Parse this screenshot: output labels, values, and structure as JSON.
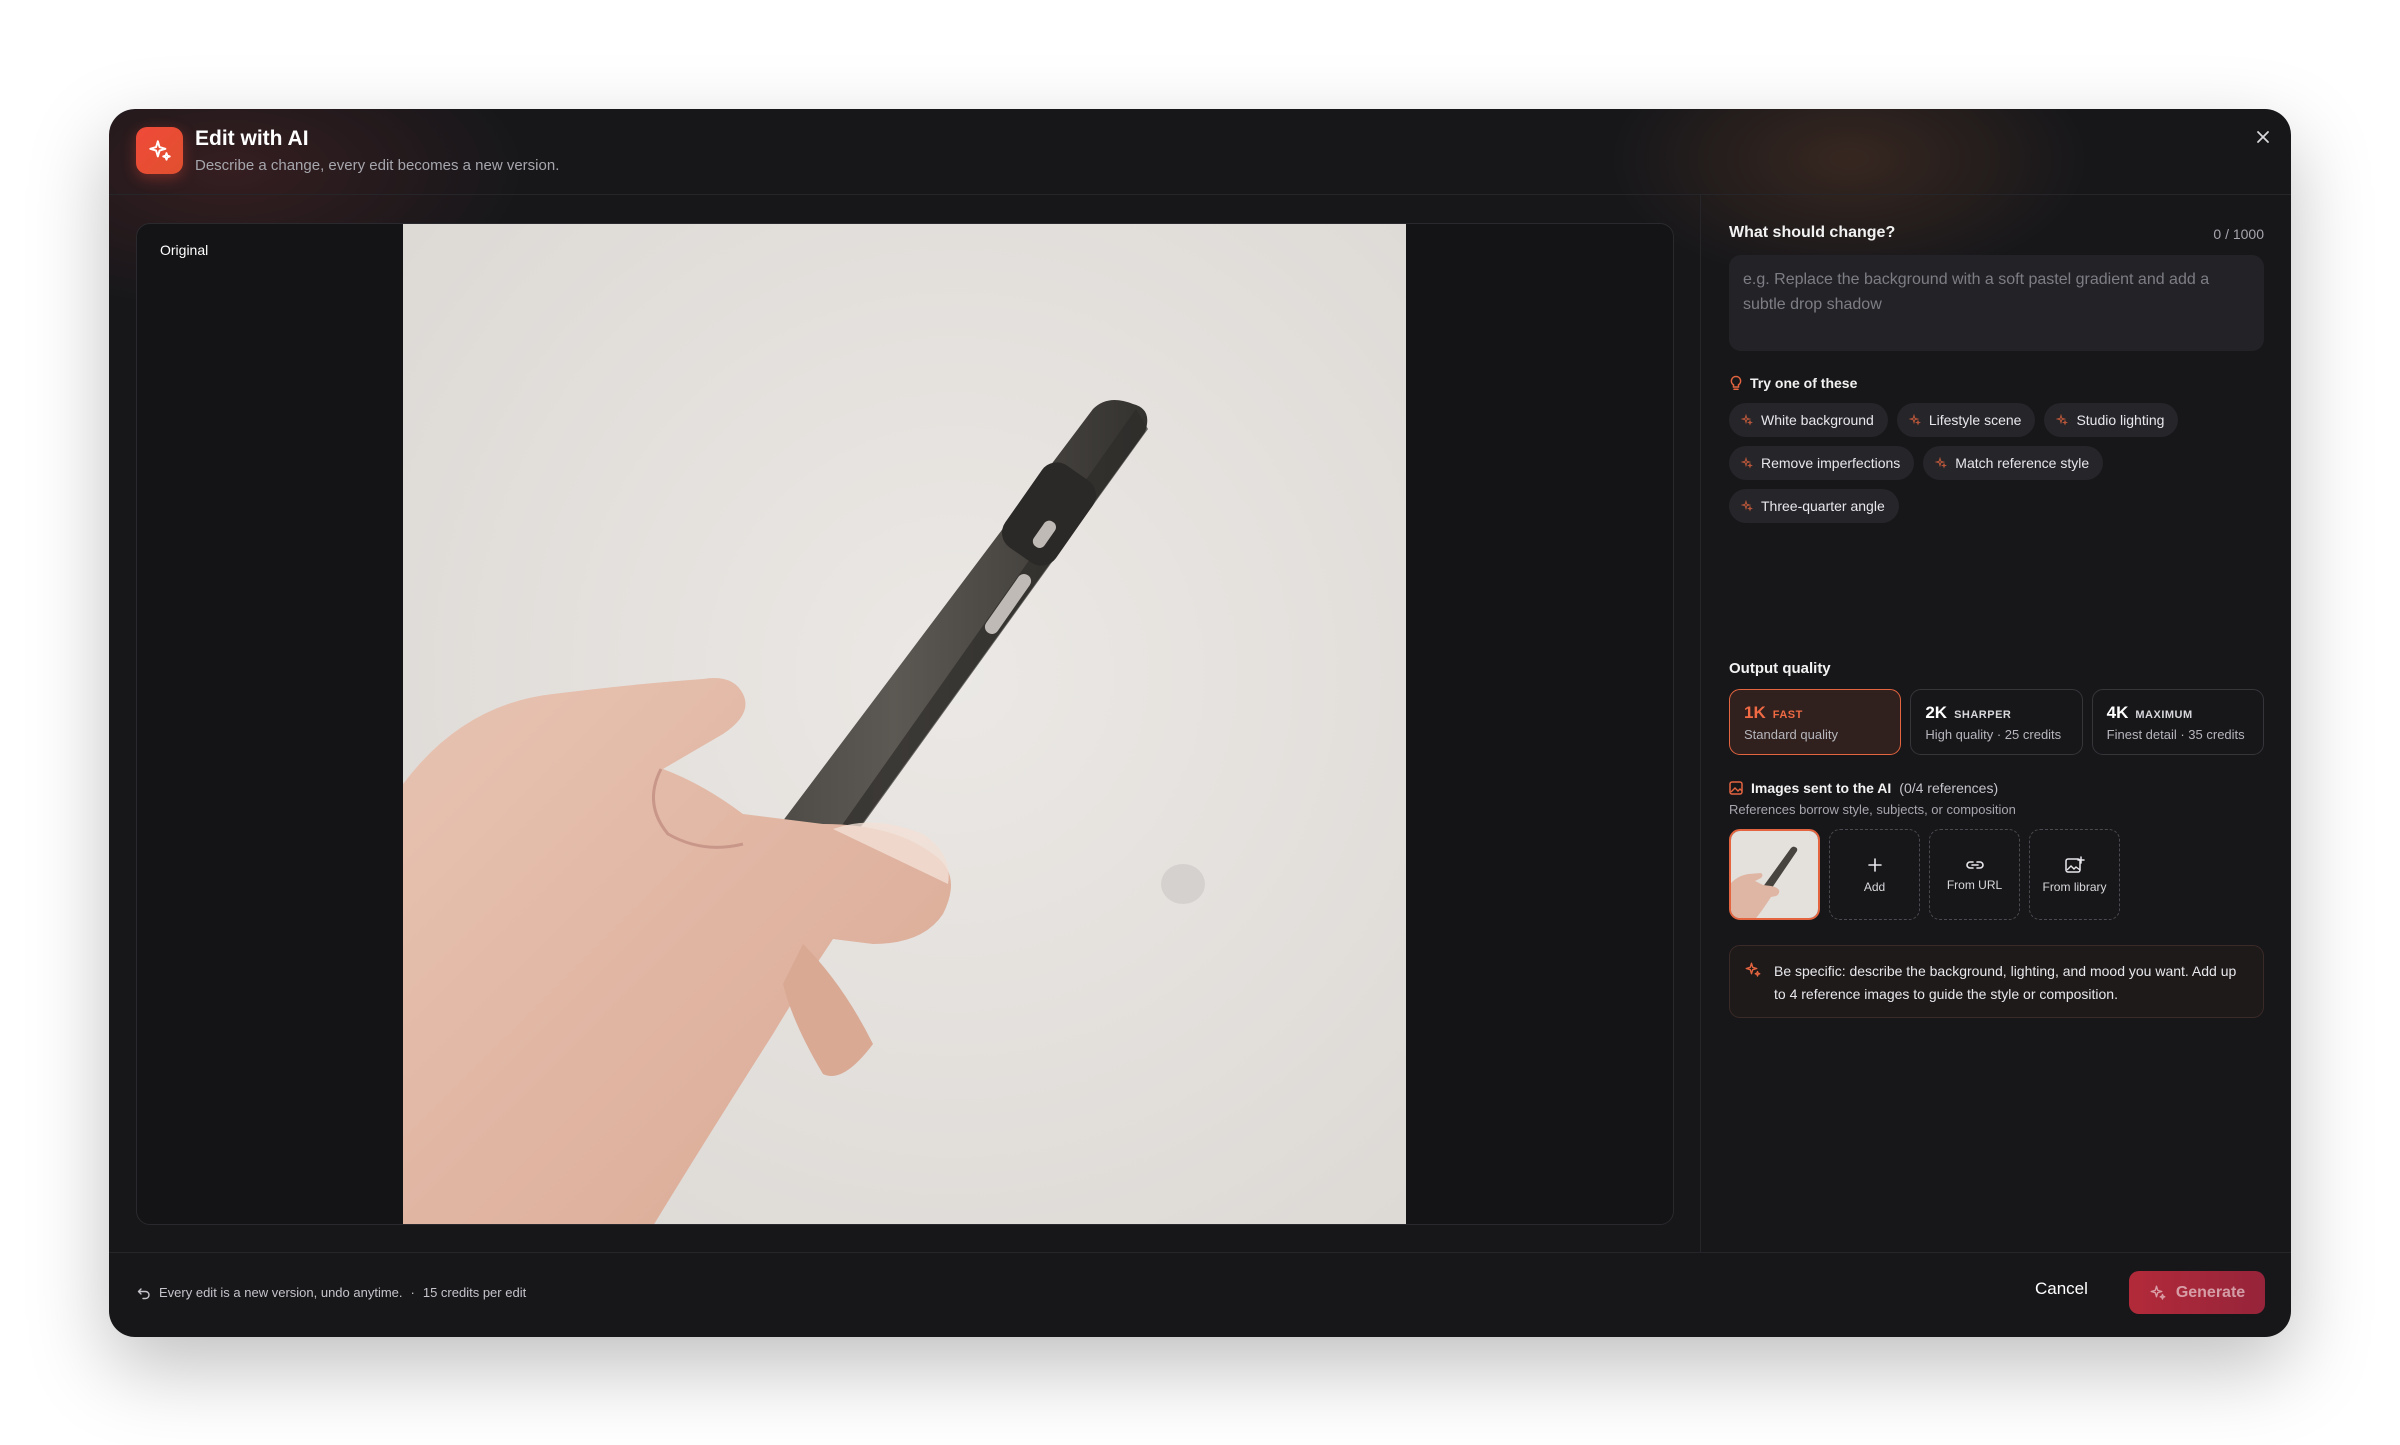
{
  "header": {
    "title": "Edit with AI",
    "subtitle": "Describe a change, every edit becomes a new version."
  },
  "preview": {
    "badge": "Original"
  },
  "prompt": {
    "label": "What should change?",
    "count": "0 / 1000",
    "placeholder": "e.g. Replace the background with a soft pastel gradient and add a subtle drop shadow"
  },
  "suggestions": {
    "label": "Try one of these",
    "items": [
      "White background",
      "Lifestyle scene",
      "Studio lighting",
      "Remove imperfections",
      "Match reference style",
      "Three-quarter angle"
    ]
  },
  "quality": {
    "label": "Output quality",
    "options": [
      {
        "res": "1K",
        "tag": "FAST",
        "desc": "Standard quality",
        "selected": true
      },
      {
        "res": "2K",
        "tag": "SHARPER",
        "desc": "High quality · 25 credits",
        "selected": false
      },
      {
        "res": "4K",
        "tag": "MAXIMUM",
        "desc": "Finest detail · 35 credits",
        "selected": false
      }
    ]
  },
  "images": {
    "label": "Images sent to the AI",
    "count": "(0/4 references)",
    "subtitle": "References borrow style, subjects, or composition",
    "slots": [
      "Add",
      "From URL",
      "From library"
    ]
  },
  "tip": "Be specific: describe the background, lighting, and mood you want. Add up to 4 reference images to guide the style or composition.",
  "footer": {
    "note": "Every edit is a new version, undo anytime.",
    "separator": "·",
    "credits": "15 credits per edit",
    "cancel": "Cancel",
    "generate": "Generate"
  },
  "colors": {
    "accent": "#e3643f",
    "generate": "#b22a3a",
    "modal_bg": "#17171a"
  },
  "icons": [
    "sparkles-icon",
    "close-icon",
    "lightbulb-icon",
    "image-icon",
    "plus-icon",
    "link-icon",
    "image-add-icon",
    "undo-icon"
  ]
}
